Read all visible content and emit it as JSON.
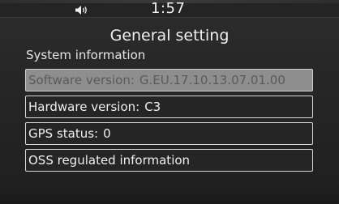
{
  "status_bar": {
    "volume_icon": "speaker-icon",
    "time": "1:57"
  },
  "page": {
    "title": "General setting",
    "section_label": "System information"
  },
  "items": [
    {
      "key": "Software version:",
      "value": "G.EU.17.10.13.07.01.00",
      "state": "disabled"
    },
    {
      "key": "Hardware version:",
      "value": "C3",
      "state": "normal"
    },
    {
      "key": "GPS status:",
      "value": "0",
      "state": "normal"
    },
    {
      "key": "OSS regulated information",
      "value": "",
      "state": "normal"
    }
  ],
  "colors": {
    "background": "#252525",
    "border": "#d8d8d8",
    "disabled_fill": "#8e8e8e",
    "disabled_text": "#5a5a5a",
    "text": "#f0f0f0"
  }
}
